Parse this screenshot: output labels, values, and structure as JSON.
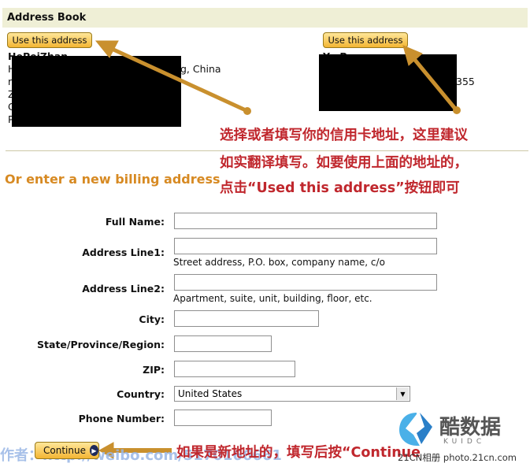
{
  "header": {
    "title": "Address Book"
  },
  "address_cards": [
    {
      "button_label": "Use this address",
      "name": "HePeiZhan",
      "line1": "H",
      "line1_suffix": "g, China",
      "line2": "r",
      "line3": "Z",
      "line4": "C",
      "line5": "P"
    },
    {
      "button_label": "Use this address",
      "name": "Yu Pe",
      "line2_suffix": "355"
    }
  ],
  "annotation_top": {
    "line1": "选择或者填写你的信用卡地址，这里建议",
    "line2": "如实翻译填写。如要使用上面的地址的，",
    "line3": "点击“Used this address”按钮即可"
  },
  "section_title": "Or enter a new billing address",
  "form": {
    "full_name": {
      "label": "Full Name:",
      "value": ""
    },
    "address_line1": {
      "label": "Address Line1:",
      "value": "",
      "hint": "Street address, P.O. box, company name, c/o"
    },
    "address_line2": {
      "label": "Address Line2:",
      "value": "",
      "hint": "Apartment, suite, unit, building, floor, etc."
    },
    "city": {
      "label": "City:",
      "value": ""
    },
    "state": {
      "label": "State/Province/Region:",
      "value": ""
    },
    "zip": {
      "label": "ZIP:",
      "value": ""
    },
    "country": {
      "label": "Country:",
      "selected": "United States"
    },
    "phone": {
      "label": "Phone Number:",
      "value": ""
    }
  },
  "continue_button": {
    "label": "Continue"
  },
  "annotation_bottom": "如果是新地址的，填写后按“Continue",
  "watermark": "作者：http://weibo.com/5170166661",
  "logo": {
    "text": "酷数据",
    "sub": "KUIDC"
  },
  "footer_credit": "21CN相册 photo.21cn.com",
  "colors": {
    "annotation": "#c0272d",
    "arrow": "#c9902e",
    "section_title": "#d78a23",
    "header_bg": "#efefd6"
  }
}
